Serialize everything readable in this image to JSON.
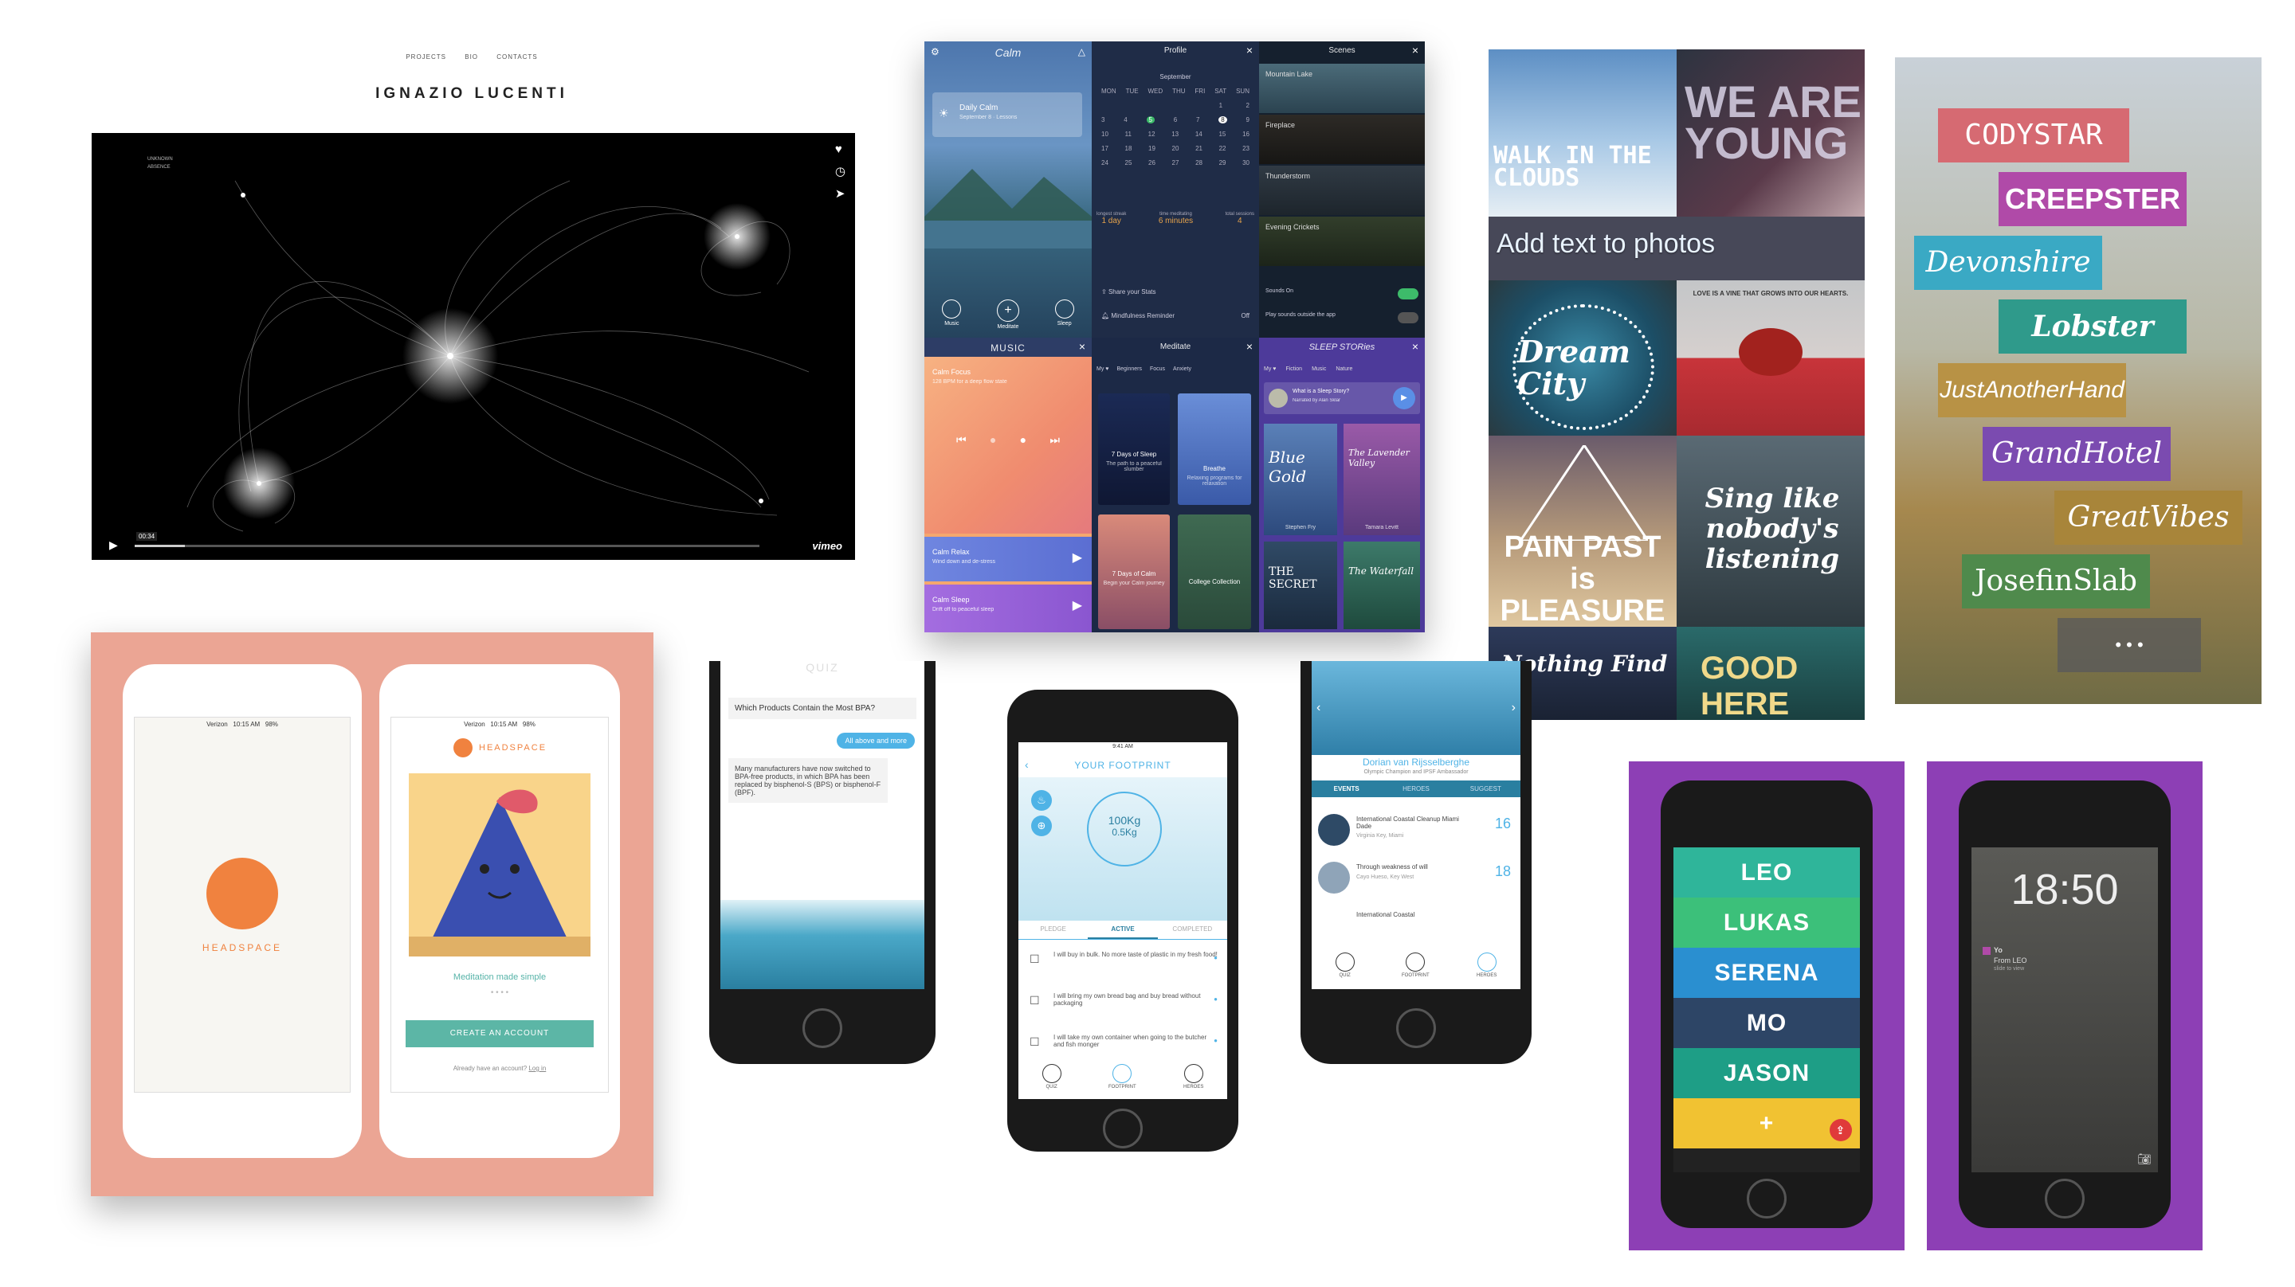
{
  "portfolio": {
    "nav": [
      "PROJECTS",
      "BIO",
      "CONTACTS"
    ],
    "title": "IGNAZIO LUCENTI",
    "video": {
      "label_lines": [
        "UNKNOWN",
        "ABSENCE"
      ],
      "timecode": "00:34",
      "brand": "vimeo"
    }
  },
  "calm": {
    "app_name": "Calm",
    "daily_calm": {
      "title": "Daily Calm",
      "subtitle": "September 8 · Lessons"
    },
    "tabbar": [
      "Music",
      "Meditate",
      "Sleep"
    ],
    "profile": {
      "header": "Profile",
      "month": "September",
      "weekdays": [
        "MON",
        "TUE",
        "WED",
        "THU",
        "FRI",
        "SAT",
        "SUN"
      ],
      "stats": [
        {
          "label": "longest streak",
          "value": "1 day"
        },
        {
          "label": "time meditating",
          "value": "6 minutes"
        },
        {
          "label": "total sessions",
          "value": "4"
        }
      ],
      "share": "Share your Stats",
      "reminder": "Mindfulness Reminder",
      "reminder_state": "Off"
    },
    "scenes": {
      "header": "Scenes",
      "items": [
        "Mountain Lake",
        "Fireplace",
        "Thunderstorm",
        "Evening Crickets"
      ],
      "sounds_on": "Sounds On",
      "play_outside": "Play sounds outside the app"
    },
    "music": {
      "header": "MUSIC",
      "focus_title": "Calm Focus",
      "focus_sub": "128 BPM for a deep flow state",
      "relax_title": "Calm Relax",
      "relax_sub": "Wind down and de-stress",
      "sleep_title": "Calm Sleep",
      "sleep_sub": "Drift off to peaceful sleep"
    },
    "meditate": {
      "header": "Meditate",
      "tabs": [
        "My ♥",
        "Beginners",
        "Focus",
        "Anxiety"
      ],
      "cards": [
        {
          "title": "7 Days of Sleep",
          "sub": "The path to a peaceful slumber"
        },
        {
          "title": "Breathe",
          "sub": "Relaxing programs for relaxation"
        },
        {
          "title": "7 Days of Calm",
          "sub": "Begin your Calm journey"
        },
        {
          "title": "College Collection",
          "sub": ""
        }
      ]
    },
    "sleep": {
      "header": "SLEEP STORies",
      "tabs": [
        "My ♥",
        "Fiction",
        "Music",
        "Nature"
      ],
      "intro": "What is a Sleep Story?",
      "intro_sub": "Narrated by Alan Sklar",
      "covers": [
        {
          "title": "Blue Gold",
          "author": "Stephen Fry"
        },
        {
          "title": "The Lavender Valley",
          "author": "Tamara Levitt"
        },
        {
          "title": "THE SECRET",
          "author": ""
        },
        {
          "title": "The Waterfall",
          "author": ""
        }
      ]
    }
  },
  "photo_text": {
    "headline": "Add text to photos",
    "tiles": [
      {
        "text": "WALK IN THE CLOUDS"
      },
      {
        "text": "WE ARE YOUNG"
      },
      {
        "text": "Dream City"
      },
      {
        "text": "LOVE IS A VINE THAT GROWS INTO OUR HEARTS."
      },
      {
        "text": "PAIN PAST is PLEASURE"
      },
      {
        "text": "Sing like nobody's listening"
      },
      {
        "text": "Nothing Find"
      },
      {
        "text": "GOOD HERE"
      }
    ]
  },
  "fonts": {
    "items": [
      {
        "name": "CODYSTAR",
        "color": "#d66a72"
      },
      {
        "name": "CREEPSTER",
        "color": "#b04aa8"
      },
      {
        "name": "Devonshire",
        "color": "#3aa9c4"
      },
      {
        "name": "Lobster",
        "color": "#2f9a8b"
      },
      {
        "name": "JustAnotherHand",
        "color": "#b89245"
      },
      {
        "name": "GrandHotel",
        "color": "#7b4bb0"
      },
      {
        "name": "GreatVibes",
        "color": "#a8853a"
      },
      {
        "name": "JosefinSlab",
        "color": "#4f8a4c"
      }
    ],
    "more": "• • •"
  },
  "headspace": {
    "status_carrier": "Verizon",
    "status_time": "10:15 AM",
    "status_battery": "98%",
    "logo_text": "HEADSPACE",
    "brand_small": "HEADSPACE",
    "tagline": "Meditation made simple",
    "cta": "CREATE AN ACCOUNT",
    "login_prompt": "Already have an account?",
    "login_link": "Log in"
  },
  "quiz": {
    "header": "QUIZ",
    "question": "Which Products Contain the Most BPA?",
    "answer": "All above and more",
    "explanation": "Many manufacturers have now switched to BPA-free products, in which BPA has been replaced by bisphenol-S (BPS) or bisphenol-F (BPF)."
  },
  "footprint": {
    "status_time": "9:41 AM",
    "title": "YOUR FOOTPRINT",
    "value_main": "100Kg",
    "value_sub": "0.5Kg",
    "tabs": [
      "PLEDGE",
      "ACTIVE",
      "COMPLETED"
    ],
    "pledges": [
      "I will buy in bulk. No more taste of plastic in my fresh food!",
      "I will bring my own bread bag and buy bread without packaging",
      "I will take my own container when going to the butcher and fish monger"
    ],
    "nav": [
      "QUIZ",
      "FOOTPRINT",
      "HEROES"
    ]
  },
  "heroes": {
    "name": "Dorian van Rijsselberghe",
    "subtitle": "Olympic Champion and IPSF Ambassador",
    "tabs": [
      "EVENTS",
      "HEROES",
      "SUGGEST"
    ],
    "events": [
      {
        "title": "International Coastal Cleanup Miami Dade",
        "place": "Virginia Key, Miami",
        "day": "16"
      },
      {
        "title": "Through weakness of will",
        "place": "Cayo Hueso, Key West",
        "day": "18"
      },
      {
        "title": "International Coastal",
        "place": "",
        "day": ""
      }
    ],
    "nav": [
      "QUIZ",
      "FOOTPRINT",
      "HEROES"
    ]
  },
  "yo": {
    "contacts": [
      {
        "name": "LEO",
        "color": "#2fb59a"
      },
      {
        "name": "LUKAS",
        "color": "#3cc07a"
      },
      {
        "name": "SERENA",
        "color": "#2a8fd0"
      },
      {
        "name": "MO",
        "color": "#2d4566"
      },
      {
        "name": "JASON",
        "color": "#1e9e86"
      },
      {
        "name": "+",
        "color": "#f1c232"
      }
    ],
    "lock_time": "18:50",
    "notif_title": "Yo",
    "notif_body": "From LEO",
    "notif_hint": "slide to view"
  }
}
